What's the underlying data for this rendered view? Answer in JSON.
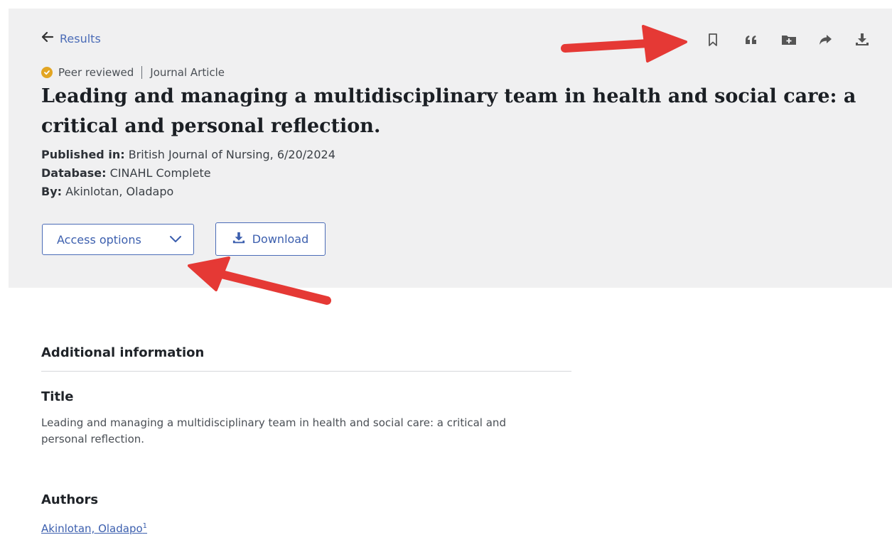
{
  "nav": {
    "back_label": "Results"
  },
  "toolbar": {
    "icons": [
      "bookmark-icon",
      "quote-icon",
      "folder-plus-icon",
      "share-icon",
      "download-icon"
    ]
  },
  "article": {
    "peer_reviewed": "Peer reviewed",
    "type": "Journal Article",
    "title": "Leading and managing a multidisciplinary team in health and social care: a critical and personal reflection.",
    "published_in_label": "Published in:",
    "published_in": "British Journal of Nursing, 6/20/2024",
    "database_label": "Database:",
    "database": "CINAHL Complete",
    "by_label": "By:",
    "by": "Akinlotan, Oladapo"
  },
  "actions": {
    "access_options": "Access options",
    "download": "Download"
  },
  "additional": {
    "heading": "Additional information",
    "title_label": "Title",
    "title_value": "Leading and managing a multidisciplinary team in health and social care: a critical and personal reflection.",
    "authors_label": "Authors",
    "author_name": "Akinlotan, Oladapo",
    "author_sup": "1"
  },
  "colors": {
    "panel_bg": "#f0f0f1",
    "link": "#4b6cb7",
    "badge": "#e2a523",
    "annotation_arrow": "#e53935"
  }
}
